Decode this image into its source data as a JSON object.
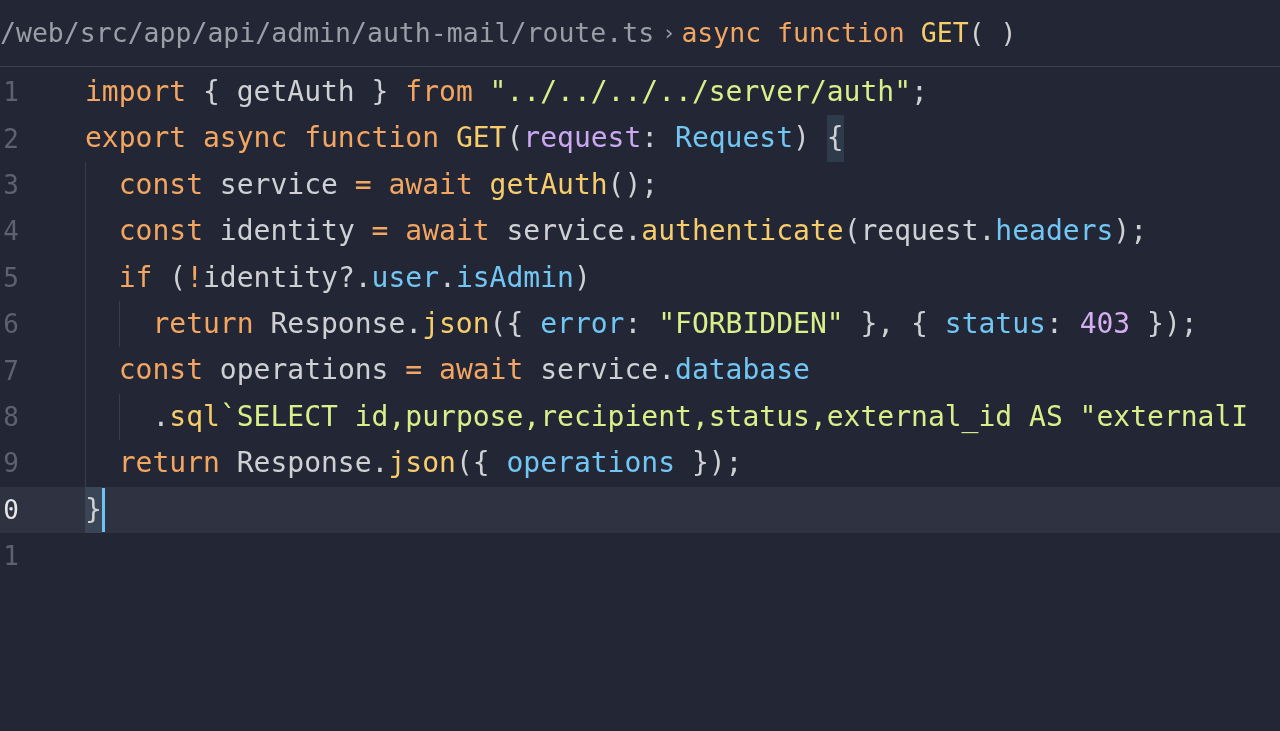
{
  "breadcrumb": {
    "path": "/web/src/app/api/admin/auth-mail/route.ts",
    "separator": "›",
    "symbol": [
      {
        "kind": "keyword",
        "text": "async function "
      },
      {
        "kind": "function",
        "text": "GET"
      },
      {
        "kind": "plain",
        "text": "( )"
      }
    ]
  },
  "lines": [
    {
      "number": "1",
      "current": false,
      "tokens": [
        {
          "kind": "keyword",
          "text": "import"
        },
        {
          "kind": "plain",
          "text": " { getAuth } "
        },
        {
          "kind": "keyword",
          "text": "from "
        },
        {
          "kind": "string",
          "text": "\"../../../../server/auth\""
        },
        {
          "kind": "plain",
          "text": ";"
        }
      ]
    },
    {
      "number": "2",
      "current": false,
      "tokens": [
        {
          "kind": "keyword",
          "text": "export async function "
        },
        {
          "kind": "function",
          "text": "GET"
        },
        {
          "kind": "plain",
          "text": "("
        },
        {
          "kind": "param",
          "text": "request"
        },
        {
          "kind": "plain",
          "text": ": "
        },
        {
          "kind": "property",
          "text": "Request"
        },
        {
          "kind": "plain",
          "text": ") "
        },
        {
          "kind": "bracket",
          "text": "{"
        }
      ]
    },
    {
      "number": "3",
      "current": false,
      "tokens": [
        {
          "kind": "keyword",
          "text": "  const"
        },
        {
          "kind": "plain",
          "text": " service "
        },
        {
          "kind": "keyword",
          "text": "= await "
        },
        {
          "kind": "function",
          "text": "getAuth"
        },
        {
          "kind": "plain",
          "text": "();"
        }
      ]
    },
    {
      "number": "4",
      "current": false,
      "tokens": [
        {
          "kind": "keyword",
          "text": "  const"
        },
        {
          "kind": "plain",
          "text": " identity "
        },
        {
          "kind": "keyword",
          "text": "= await"
        },
        {
          "kind": "plain",
          "text": " service."
        },
        {
          "kind": "function",
          "text": "authenticate"
        },
        {
          "kind": "plain",
          "text": "(request."
        },
        {
          "kind": "property",
          "text": "headers"
        },
        {
          "kind": "plain",
          "text": ");"
        }
      ]
    },
    {
      "number": "5",
      "current": false,
      "tokens": [
        {
          "kind": "keyword",
          "text": "  if"
        },
        {
          "kind": "plain",
          "text": " ("
        },
        {
          "kind": "keyword",
          "text": "!"
        },
        {
          "kind": "plain",
          "text": "identity?."
        },
        {
          "kind": "property",
          "text": "user"
        },
        {
          "kind": "plain",
          "text": "."
        },
        {
          "kind": "property",
          "text": "isAdmin"
        },
        {
          "kind": "plain",
          "text": ")"
        }
      ]
    },
    {
      "number": "6",
      "current": false,
      "tokens": [
        {
          "kind": "keyword",
          "text": "    return"
        },
        {
          "kind": "plain",
          "text": " Response."
        },
        {
          "kind": "function",
          "text": "json"
        },
        {
          "kind": "plain",
          "text": "({ "
        },
        {
          "kind": "property",
          "text": "error"
        },
        {
          "kind": "plain",
          "text": ": "
        },
        {
          "kind": "string",
          "text": "\"FORBIDDEN\""
        },
        {
          "kind": "plain",
          "text": " }, { "
        },
        {
          "kind": "property",
          "text": "status"
        },
        {
          "kind": "plain",
          "text": ": "
        },
        {
          "kind": "number",
          "text": "403"
        },
        {
          "kind": "plain",
          "text": " });"
        }
      ]
    },
    {
      "number": "7",
      "current": false,
      "tokens": [
        {
          "kind": "keyword",
          "text": "  const"
        },
        {
          "kind": "plain",
          "text": " operations "
        },
        {
          "kind": "keyword",
          "text": "= await"
        },
        {
          "kind": "plain",
          "text": " service."
        },
        {
          "kind": "property",
          "text": "database"
        }
      ]
    },
    {
      "number": "8",
      "current": false,
      "tokens": [
        {
          "kind": "plain",
          "text": "    ."
        },
        {
          "kind": "function",
          "text": "sql"
        },
        {
          "kind": "string",
          "text": "`SELECT id,purpose,recipient,status,external_id AS \"externalI"
        }
      ]
    },
    {
      "number": "9",
      "current": false,
      "tokens": [
        {
          "kind": "keyword",
          "text": "  return"
        },
        {
          "kind": "plain",
          "text": " Response."
        },
        {
          "kind": "function",
          "text": "json"
        },
        {
          "kind": "plain",
          "text": "({ "
        },
        {
          "kind": "property",
          "text": "operations"
        },
        {
          "kind": "plain",
          "text": " });"
        }
      ]
    },
    {
      "number": "0",
      "current": true,
      "tokens": [
        {
          "kind": "bracket",
          "text": "}"
        }
      ]
    },
    {
      "number": "1",
      "current": false
    }
  ]
}
